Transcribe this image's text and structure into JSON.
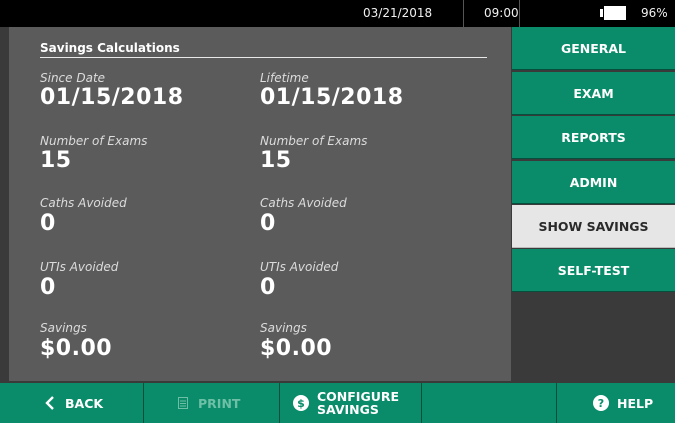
{
  "status": {
    "date": "03/21/2018",
    "time": "09:00",
    "battery": "96%",
    "battery_level": 0.96
  },
  "main": {
    "title": "Savings Calculations",
    "since_date": {
      "label": "Since Date",
      "value": "01/15/2018"
    },
    "lifetime": {
      "label": "Lifetime",
      "value": "01/15/2018"
    },
    "exams_left": {
      "label": "Number of Exams",
      "value": "15"
    },
    "exams_right": {
      "label": "Number of Exams",
      "value": "15"
    },
    "caths_left": {
      "label": "Caths Avoided",
      "value": "0"
    },
    "caths_right": {
      "label": "Caths Avoided",
      "value": "0"
    },
    "utis_left": {
      "label": "UTIs Avoided",
      "value": "0"
    },
    "utis_right": {
      "label": "UTIs Avoided",
      "value": "0"
    },
    "savings_left": {
      "label": "Savings",
      "value": "$0.00"
    },
    "savings_right": {
      "label": "Savings",
      "value": "$0.00"
    }
  },
  "nav": {
    "general": "GENERAL",
    "exam": "EXAM",
    "reports": "REPORTS",
    "admin": "ADMIN",
    "show_savings": "SHOW SAVINGS",
    "self_test": "SELF-TEST"
  },
  "bottom": {
    "back": "BACK",
    "print": "PRINT",
    "configure_line1": "CONFIGURE",
    "configure_line2": "SAVINGS",
    "help": "HELP"
  },
  "colors": {
    "accent": "#0a8c6a",
    "panel": "#5b5b5b",
    "background": "#3a3a3a"
  }
}
